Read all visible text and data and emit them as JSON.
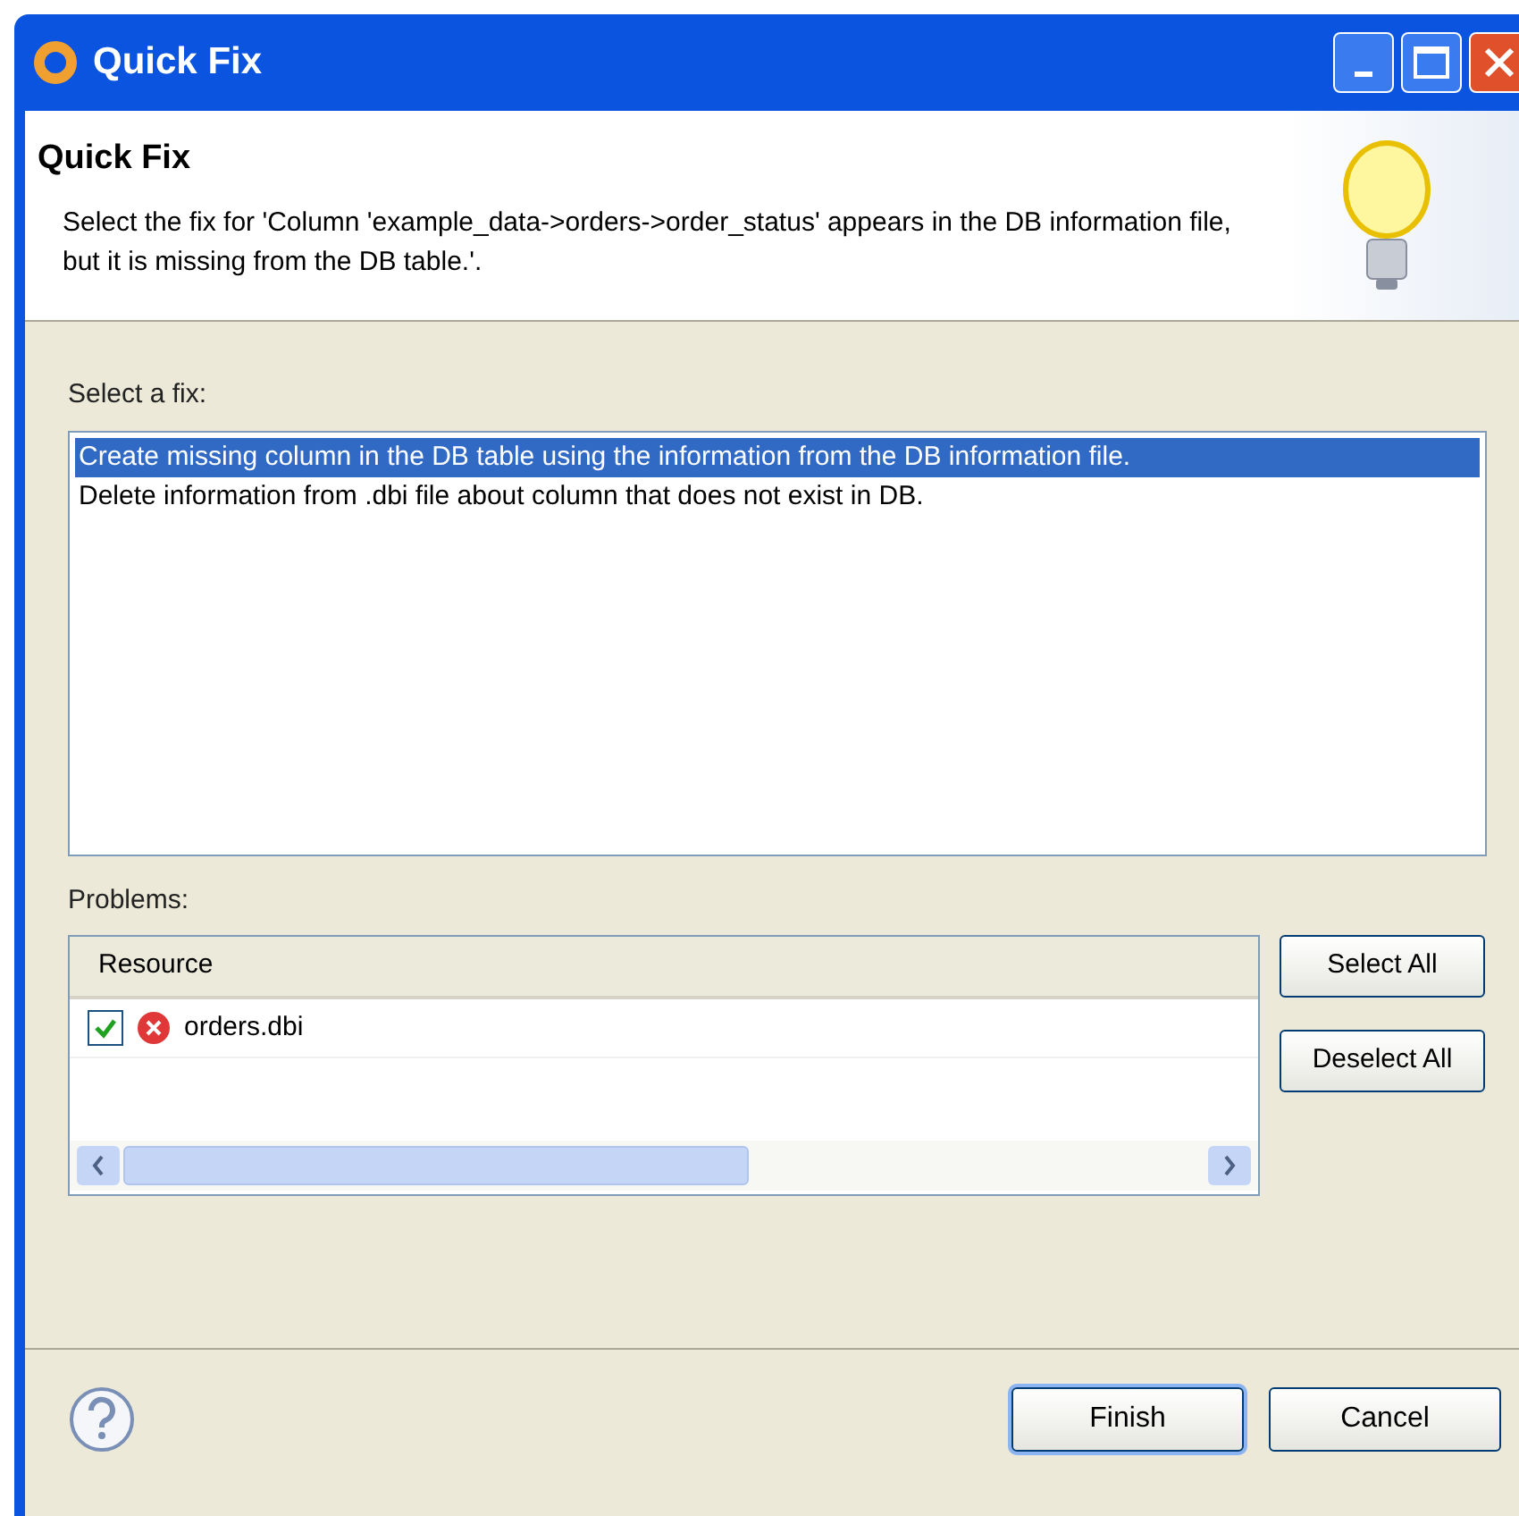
{
  "window": {
    "title": "Quick Fix"
  },
  "header": {
    "title": "Quick Fix",
    "description": "Select the fix for 'Column 'example_data->orders->order_status' appears in the DB information file, but it is missing from the DB table.'."
  },
  "fixes": {
    "label": "Select a fix:",
    "items": [
      {
        "text": "Create missing column in the DB table using the information from the DB information file.",
        "selected": true
      },
      {
        "text": "Delete information from .dbi file about column that does not exist in DB.",
        "selected": false
      }
    ]
  },
  "problems": {
    "label": "Problems:",
    "column": "Resource",
    "rows": [
      {
        "name": "orders.dbi",
        "checked": true
      }
    ],
    "buttons": [
      "Select All",
      "Deselect All"
    ]
  },
  "footer": {
    "buttons": [
      {
        "label": "Finish",
        "default": true
      },
      {
        "label": "Cancel",
        "default": false
      }
    ]
  }
}
